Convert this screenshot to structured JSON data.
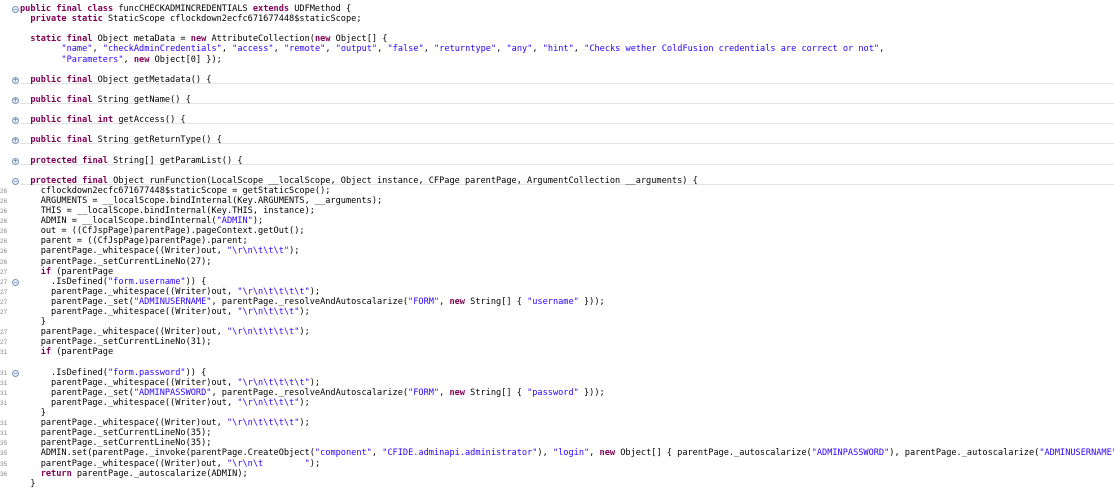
{
  "editor": {
    "lines": [
      {
        "num": "",
        "fold": "−",
        "code": "%%public final class%% funcCHECKADMINCREDENTIALS %%extends%% UDFMethod {"
      },
      {
        "num": "",
        "fold": "",
        "code": "  %%private static%% StaticScope cflockdown2ecfc671677448$staticScope;"
      },
      {
        "num": "",
        "fold": "",
        "code": ""
      },
      {
        "num": "",
        "fold": "",
        "code": "  %%static final%% Object metaData = %%new%% AttributeCollection(%%new%% Object[] {"
      },
      {
        "num": "",
        "fold": "",
        "code": "        ~~\"name\"~~, ~~\"checkAdminCredentials\"~~, ~~\"access\"~~, ~~\"remote\"~~, ~~\"output\"~~, ~~\"false\"~~, ~~\"returntype\"~~, ~~\"any\"~~, ~~\"hint\"~~, ~~\"Checks wether ColdFusion credentials are correct or not\"~~,"
      },
      {
        "num": "",
        "fold": "",
        "code": "        ~~\"Parameters\"~~, %%new%% Object[0] });"
      },
      {
        "num": "",
        "fold": "",
        "code": ""
      },
      {
        "num": "",
        "fold": "+",
        "code": "  %%public final%% Object getMetadata() {"
      },
      {
        "num": "",
        "fold": "",
        "code": ""
      },
      {
        "num": "",
        "fold": "+",
        "code": "  %%public final%% String getName() {"
      },
      {
        "num": "",
        "fold": "",
        "code": ""
      },
      {
        "num": "",
        "fold": "+",
        "code": "  %%public final int%% getAccess() {"
      },
      {
        "num": "",
        "fold": "",
        "code": ""
      },
      {
        "num": "",
        "fold": "+",
        "code": "  %%public final%% String getReturnType() {"
      },
      {
        "num": "",
        "fold": "",
        "code": ""
      },
      {
        "num": "",
        "fold": "+",
        "code": "  %%protected final%% String[] getParamList() {"
      },
      {
        "num": "",
        "fold": "",
        "code": ""
      },
      {
        "num": "",
        "fold": "−",
        "code": "  %%protected final%% Object runFunction(LocalScope __localScope, Object instance, CFPage parentPage, ArgumentCollection __arguments) {"
      },
      {
        "num": "26",
        "fold": "",
        "code": "    cflockdown2ecfc671677448$staticScope = getStaticScope();"
      },
      {
        "num": "26",
        "fold": "",
        "code": "    ARGUMENTS = __localScope.bindInternal(Key.ARGUMENTS, __arguments);"
      },
      {
        "num": "26",
        "fold": "",
        "code": "    THIS = __localScope.bindInternal(Key.THIS, instance);"
      },
      {
        "num": "26",
        "fold": "",
        "code": "    ADMIN = __localScope.bindInternal(~~\"ADMIN\"~~);"
      },
      {
        "num": "26",
        "fold": "",
        "code": "    out = ((CfJspPage)parentPage).pageContext.getOut();"
      },
      {
        "num": "26",
        "fold": "",
        "code": "    parent = ((CfJspPage)parentPage).parent;"
      },
      {
        "num": "26",
        "fold": "",
        "code": "    parentPage._whitespace((Writer)out, ~~\"\\r\\n\\t\\t\\t\"~~);"
      },
      {
        "num": "26",
        "fold": "",
        "code": "    parentPage._setCurrentLineNo(27);"
      },
      {
        "num": "27",
        "fold": "",
        "code": "    %%if%% (parentPage"
      },
      {
        "num": "27",
        "fold": "−",
        "code": "      .IsDefined(~~\"form.username\"~~)) {"
      },
      {
        "num": "27",
        "fold": "",
        "code": "      parentPage._whitespace((Writer)out, ~~\"\\r\\n\\t\\t\\t\\t\"~~);"
      },
      {
        "num": "27",
        "fold": "",
        "code": "      parentPage._set(~~\"ADMINUSERNAME\"~~, parentPage._resolveAndAutoscalarize(~~\"FORM\"~~, %%new%% String[] { ~~\"username\"~~ }));"
      },
      {
        "num": "27",
        "fold": "",
        "code": "      parentPage._whitespace((Writer)out, ~~\"\\r\\n\\t\\t\\t\"~~);"
      },
      {
        "num": "",
        "fold": "",
        "code": "    }"
      },
      {
        "num": "27",
        "fold": "",
        "code": "    parentPage._whitespace((Writer)out, ~~\"\\r\\n\\t\\t\\t\\t\"~~);"
      },
      {
        "num": "27",
        "fold": "",
        "code": "    parentPage._setCurrentLineNo(31);"
      },
      {
        "num": "31",
        "fold": "",
        "code": "    %%if%% (parentPage"
      },
      {
        "num": "",
        "fold": "",
        "code": ""
      },
      {
        "num": "31",
        "fold": "−",
        "code": "      .IsDefined(~~\"form.password\"~~)) {"
      },
      {
        "num": "31",
        "fold": "",
        "code": "      parentPage._whitespace((Writer)out, ~~\"\\r\\n\\t\\t\\t\\t\"~~);"
      },
      {
        "num": "31",
        "fold": "",
        "code": "      parentPage._set(~~\"ADMINPASSWORD\"~~, parentPage._resolveAndAutoscalarize(~~\"FORM\"~~, %%new%% String[] { ~~\"password\"~~ }));"
      },
      {
        "num": "31",
        "fold": "",
        "code": "      parentPage._whitespace((Writer)out, ~~\"\\r\\n\\t\\t\\t\"~~);"
      },
      {
        "num": "",
        "fold": "",
        "code": "    }"
      },
      {
        "num": "31",
        "fold": "",
        "code": "    parentPage._whitespace((Writer)out, ~~\"\\r\\n\\t\\t\\t\\t\"~~);"
      },
      {
        "num": "31",
        "fold": "",
        "code": "    parentPage._setCurrentLineNo(35);"
      },
      {
        "num": "35",
        "fold": "",
        "code": "    parentPage._setCurrentLineNo(35);"
      },
      {
        "num": "35",
        "fold": "",
        "code": "    ADMIN.set(parentPage._invoke(parentPage.CreateObject(~~\"component\"~~, ~~\"CFIDE.adminapi.administrator\"~~), ~~\"login\"~~, %%new%% Object[] { parentPage._autoscalarize(~~\"ADMINPASSWORD\"~~), parentPage._autoscalarize(~~\"ADMINUSERNAME\"~~) }));"
      },
      {
        "num": "35",
        "fold": "",
        "code": "    parentPage._whitespace((Writer)out, ~~\"\\r\\n\\t        \"~~);"
      },
      {
        "num": "36",
        "fold": "",
        "code": "    %%return%% parentPage._autoscalarize(ADMIN);"
      },
      {
        "num": "",
        "fold": "",
        "code": "  }"
      }
    ]
  }
}
